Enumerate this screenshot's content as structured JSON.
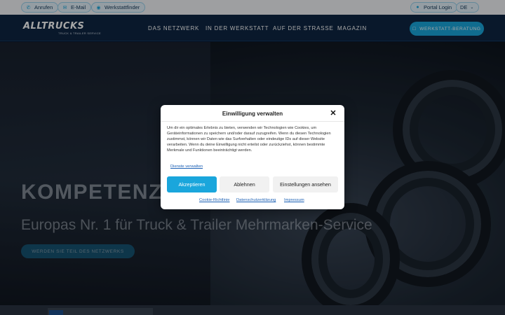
{
  "topbar": {
    "call_label": "Anrufen",
    "email_label": "E-Mail",
    "finder_label": "Werkstattfinder",
    "portal_label": "Portal Login",
    "lang_label": "DE"
  },
  "nav": {
    "logo_text": "ALLTRUCKS",
    "logo_tagline": "TRUCK & TRAILER SERVICE",
    "items": [
      {
        "label": "DAS NETZWERK"
      },
      {
        "label": "IN DER WERKSTATT"
      },
      {
        "label": "AUF DER STRASSE"
      },
      {
        "label": "MAGAZIN"
      }
    ],
    "cta_label": "WERKSTATT-BERATUNG"
  },
  "hero": {
    "title": "KOMPETENZ, DIE BEWEGT.",
    "subtitle": "Europas Nr. 1 für Truck & Trailer Mehrmarken-Service",
    "button_label": "WERDEN SIE TEIL DES NETZWERKS"
  },
  "consent": {
    "title": "Einwilligung verwalten",
    "body": "Um dir ein optimales Erlebnis zu bieten, verwenden wir Technologien wie Cookies, um Geräteinformationen zu speichern und/oder darauf zuzugreifen. Wenn du diesen Technologien zustimmst, können wir Daten wie das Surfverhalten oder eindeutige IDs auf dieser Website verarbeiten. Wenn du deine Einwilligung nicht erteilst oder zurückziehst, können bestimmte Merkmale und Funktionen beeinträchtigt werden.",
    "services_link": "Dienste verwalten",
    "accept_label": "Akzeptieren",
    "deny_label": "Ablehnen",
    "settings_label": "Einstellungen ansehen",
    "cookie_policy_link": "Cookie-Richtlinie",
    "privacy_link": "Datenschutzerklärung",
    "imprint_link": "Impressum"
  },
  "colors": {
    "accent": "#1aa6dc",
    "nav_background": "#0e2542",
    "link": "#1a5fb4"
  },
  "icons": {
    "call": "phone-icon",
    "email": "mail-icon",
    "finder": "location-icon",
    "portal": "user-icon",
    "cta": "chat-icon",
    "close": "close-icon"
  }
}
